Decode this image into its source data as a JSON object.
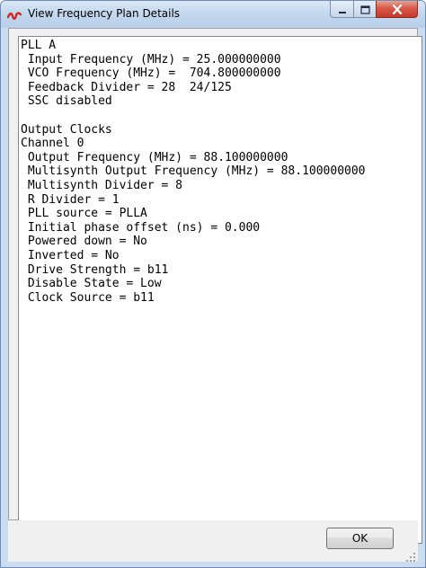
{
  "window": {
    "title": "View Frequency Plan Details",
    "icon": "app-logo-icon",
    "controls": [
      "minimize-icon",
      "maximize-icon",
      "close-icon"
    ]
  },
  "details": {
    "lines": [
      "PLL A",
      " Input Frequency (MHz) = 25.000000000",
      " VCO Frequency (MHz) =  704.800000000",
      " Feedback Divider = 28  24/125",
      " SSC disabled",
      "",
      "Output Clocks",
      "Channel 0",
      " Output Frequency (MHz) = 88.100000000",
      " Multisynth Output Frequency (MHz) = 88.100000000",
      " Multisynth Divider = 8",
      " R Divider = 1",
      " PLL source = PLLA",
      " Initial phase offset (ns) = 0.000",
      " Powered down = No",
      " Inverted = No",
      " Drive Strength = b11",
      " Disable State = Low",
      " Clock Source = b11"
    ]
  },
  "footer": {
    "ok_label": "OK"
  }
}
